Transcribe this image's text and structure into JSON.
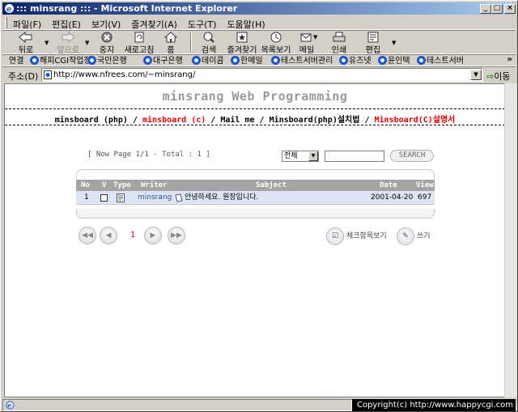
{
  "window": {
    "title": "::: minsrang ::: - Microsoft Internet Explorer",
    "min": "_",
    "max": "□",
    "close": "×"
  },
  "menu": [
    "파일(F)",
    "편집(E)",
    "보기(V)",
    "즐겨찾기(A)",
    "도구(T)",
    "도움말(H)"
  ],
  "toolbar": {
    "back": "뒤로",
    "forward": "앞으로",
    "stop": "중지",
    "refresh": "새로고침",
    "home": "홈",
    "search": "검색",
    "favorites": "즐겨찾기",
    "history": "목록보기",
    "mail": "메일",
    "print": "인쇄",
    "edit": "편집"
  },
  "links": {
    "label": "연결",
    "items": [
      "해피CGI작업장",
      "국민은행",
      "대구은행",
      "데이콤",
      "한메일",
      "테스트서버관리",
      "유즈넷",
      "윤인택",
      "테스트서버"
    ],
    "more": "»"
  },
  "address": {
    "label": "주소(D)",
    "url": "http://www.nfrees.com/~minsrang/",
    "go": "이동"
  },
  "page": {
    "site_title": "minsrang Web Programming",
    "nav": [
      {
        "text": "minsboard (php)",
        "color": "#000000"
      },
      {
        "text": "minsboard (c)",
        "color": "#e00000"
      },
      {
        "text": "Mail me",
        "color": "#000000"
      },
      {
        "text": "Minsboard(php)설치법",
        "color": "#000000"
      },
      {
        "text": "Minsboard(C)설명서",
        "color": "#e00000"
      }
    ],
    "nav_sep": " / ",
    "page_info": "[ Now Page 1/1 - Total : 1 ]",
    "search_select": "전체",
    "search_button": "SEARCH",
    "table": {
      "headers": {
        "no": "No",
        "v": "V",
        "type": "Type",
        "writer": "Writer",
        "subject": "Subject",
        "date": "Date",
        "view": "View"
      },
      "rows": [
        {
          "no": "1",
          "writer": "minsrang",
          "subject": "안녕하세요. 원장입니다.",
          "date": "2001-04-20",
          "view": "697"
        }
      ]
    },
    "pager": {
      "first": "◀◀",
      "prev": "◀",
      "current": "1",
      "next": "▶",
      "last": "▶▶"
    },
    "actions": {
      "view_checked": "체크항목보기",
      "write": "쓰기"
    }
  },
  "status": {
    "copyright": "Copyright(c) http://www.happycgi.com"
  },
  "colors": {
    "title_start": "#0a246a",
    "title_end": "#a6caf0",
    "accent_red": "#e00000",
    "row_highlight": "#dde4f4"
  }
}
